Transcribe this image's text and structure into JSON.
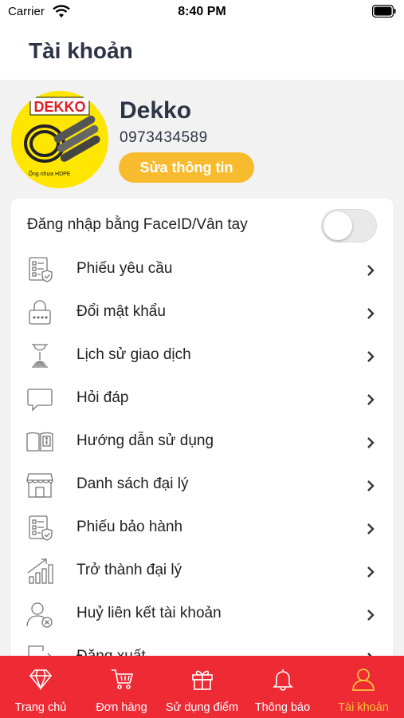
{
  "status_bar": {
    "carrier": "Carrier",
    "time": "8:40 PM"
  },
  "header": {
    "title": "Tài khoản"
  },
  "profile": {
    "name": "Dekko",
    "phone": "0973434589",
    "edit_label": "Sửa thông tin",
    "avatar_logo_text": "DEKKO",
    "avatar_caption": "Ống nhựa HDPE"
  },
  "settings": {
    "faceid_label": "Đăng nhập bằng FaceID/Vân tay",
    "faceid_enabled": false
  },
  "menu": {
    "items": [
      {
        "label": "Phiếu yêu cầu",
        "icon": "request-form-icon"
      },
      {
        "label": "Đổi mật khẩu",
        "icon": "lock-icon"
      },
      {
        "label": "Lịch sử giao dịch",
        "icon": "hourglass-icon"
      },
      {
        "label": "Hỏi đáp",
        "icon": "chat-bubble-icon"
      },
      {
        "label": "Hướng dẫn sử dụng",
        "icon": "book-info-icon"
      },
      {
        "label": "Danh sách đại lý",
        "icon": "store-icon"
      },
      {
        "label": "Phiếu bảo hành",
        "icon": "warranty-form-icon"
      },
      {
        "label": "Trở thành đại lý",
        "icon": "growth-chart-icon"
      },
      {
        "label": "Huỷ liên kết tài khoản",
        "icon": "user-remove-icon"
      },
      {
        "label": "Đăng xuất",
        "icon": "logout-icon"
      }
    ]
  },
  "tabs": [
    {
      "label": "Trang chủ",
      "icon": "diamond-icon",
      "active": false
    },
    {
      "label": "Đơn hàng",
      "icon": "cart-icon",
      "active": false
    },
    {
      "label": "Sử dụng điểm",
      "icon": "gift-icon",
      "active": false
    },
    {
      "label": "Thông báo",
      "icon": "bell-icon",
      "active": false
    },
    {
      "label": "Tài khoản",
      "icon": "user-icon",
      "active": true
    }
  ],
  "colors": {
    "accent": "#ee2a35",
    "button": "#f8bb2d",
    "active_tab": "#f7c23c",
    "title": "#2c3445"
  }
}
